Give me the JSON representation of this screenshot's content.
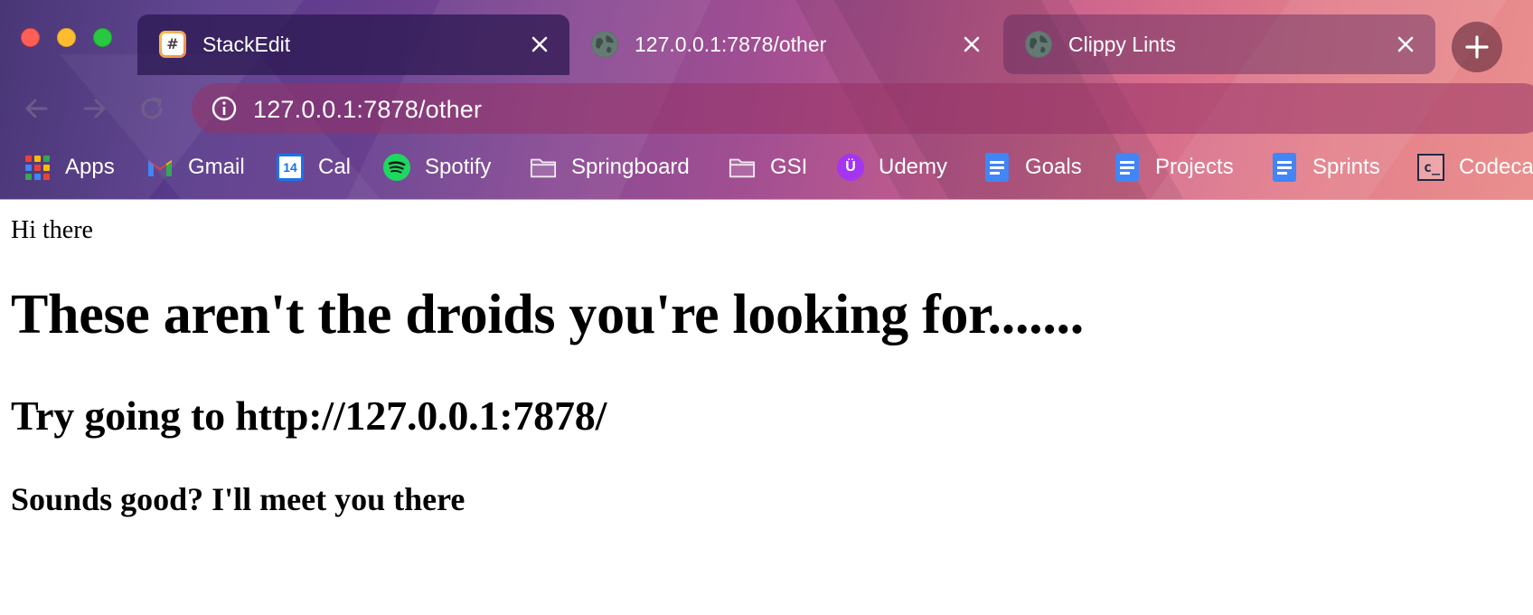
{
  "tabs": [
    {
      "title": "StackEdit",
      "favicon": "stackedit-icon",
      "favicon_glyph": "#",
      "active": false
    },
    {
      "title": "127.0.0.1:7878/other",
      "favicon": "globe-icon",
      "active": true
    },
    {
      "title": "Clippy Lints",
      "favicon": "globe-icon",
      "active": false
    }
  ],
  "toolbar": {
    "url": "127.0.0.1:7878/other"
  },
  "bookmarks": [
    {
      "label": "Apps",
      "icon": "apps-grid-icon"
    },
    {
      "label": "Gmail",
      "icon": "gmail-icon"
    },
    {
      "label": "Cal",
      "icon": "calendar-icon",
      "icon_text": "14"
    },
    {
      "label": "Spotify",
      "icon": "spotify-icon"
    },
    {
      "label": "Springboard",
      "icon": "folder-icon"
    },
    {
      "label": "GSI",
      "icon": "folder-icon"
    },
    {
      "label": "Udemy",
      "icon": "udemy-icon",
      "icon_text": "Ü"
    },
    {
      "label": "Goals",
      "icon": "docs-icon"
    },
    {
      "label": "Projects",
      "icon": "docs-icon"
    },
    {
      "label": "Sprints",
      "icon": "docs-icon"
    },
    {
      "label": "Codeca",
      "icon": "codecademy-icon",
      "icon_text": "c_"
    }
  ],
  "page": {
    "greeting": "Hi there",
    "heading": "These aren't the droids you're looking for.......",
    "subheading": "Try going to http://127.0.0.1:7878/",
    "note": "Sounds good? I'll meet you there"
  },
  "colors": {
    "traffic_red": "#ff5f57",
    "traffic_yellow": "#febc2e",
    "traffic_green": "#28c840",
    "spotify_green": "#1ed760",
    "udemy_purple": "#a435f0",
    "docs_blue": "#4285f4"
  }
}
